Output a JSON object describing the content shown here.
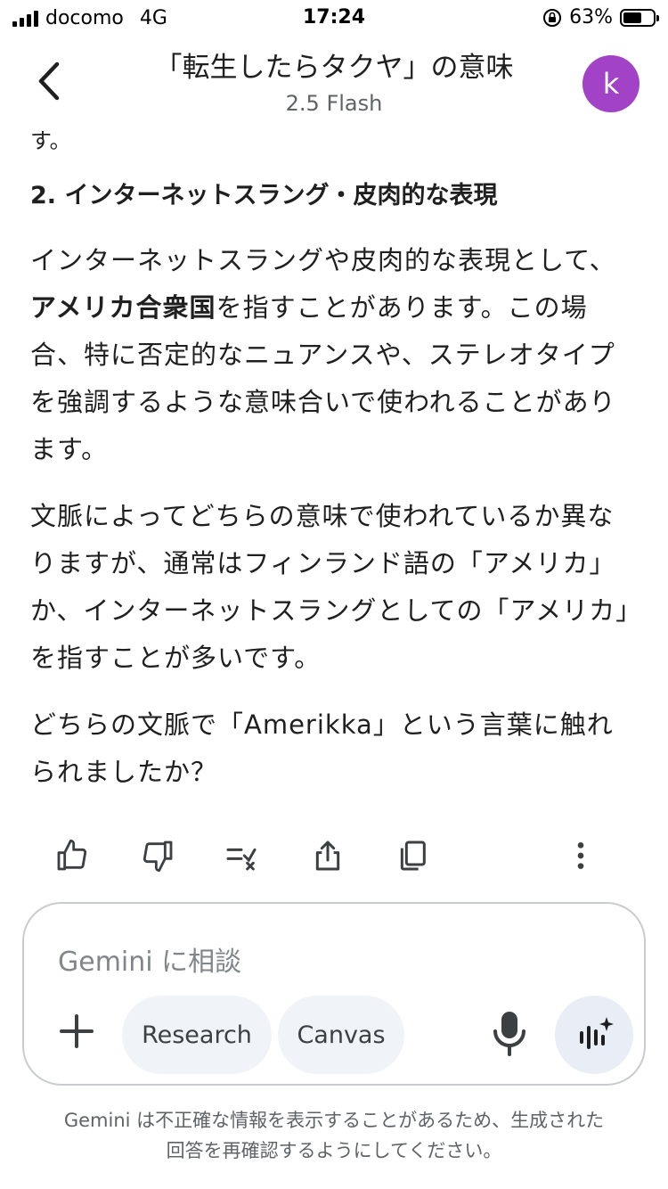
{
  "status_bar": {
    "carrier": "docomo",
    "network": "4G",
    "time": "17:24",
    "battery_percent": "63%",
    "battery_level": 0.63
  },
  "header": {
    "title": "「転生したらタクヤ」の意味",
    "subtitle": "2.5 Flash",
    "avatar_letter": "k",
    "avatar_color": "#a142c7"
  },
  "message": {
    "fragment": "す。",
    "heading": "2. インターネットスラング・皮肉的な表現",
    "p1_a": "インターネットスラングや皮肉的な表現として、",
    "p1_bold": "アメリカ合衆国",
    "p1_b": "を指すことがあります。この場合、特に否定的なニュアンスや、ステレオタイプを強調するような意味合いで使われることがあります。",
    "p2": "文脈によってどちらの意味で使われているか異なりますが、通常はフィンランド語の「アメリカ」か、インターネットスラングとしての「アメリカ」を指すことが多いです。",
    "p3": "どちらの文脈で「Amerikka」という言葉に触れられましたか？"
  },
  "actions": {
    "icons": [
      "thumb-up-icon",
      "thumb-down-icon",
      "double-check-icon",
      "share-icon",
      "copy-icon",
      "more-vert-icon"
    ]
  },
  "input": {
    "placeholder": "Gemini に相談",
    "chip_research": "Research",
    "chip_canvas": "Canvas"
  },
  "disclaimer": {
    "line1": "Gemini は不正確な情報を表示することがあるため、生成された",
    "line2": "回答を再確認するようにしてください。"
  }
}
